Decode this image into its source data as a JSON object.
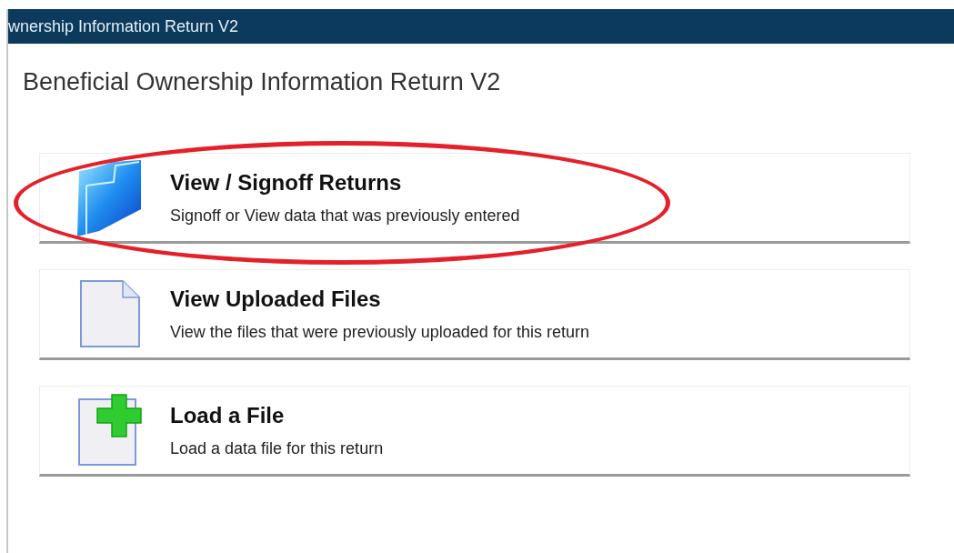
{
  "window": {
    "title": "wnership Information Return V2"
  },
  "heading": "Beneficial Ownership Information Return V2",
  "actions": [
    {
      "kind": "folder",
      "title": "View / Signoff Returns",
      "description": "Signoff or View data that was previously entered",
      "circled": true
    },
    {
      "kind": "document",
      "title": "View Uploaded Files",
      "description": "View the files that were previously uploaded for this return",
      "circled": false
    },
    {
      "kind": "add-document",
      "title": "Load a File",
      "description": "Load a data file for this return",
      "circled": false
    }
  ]
}
